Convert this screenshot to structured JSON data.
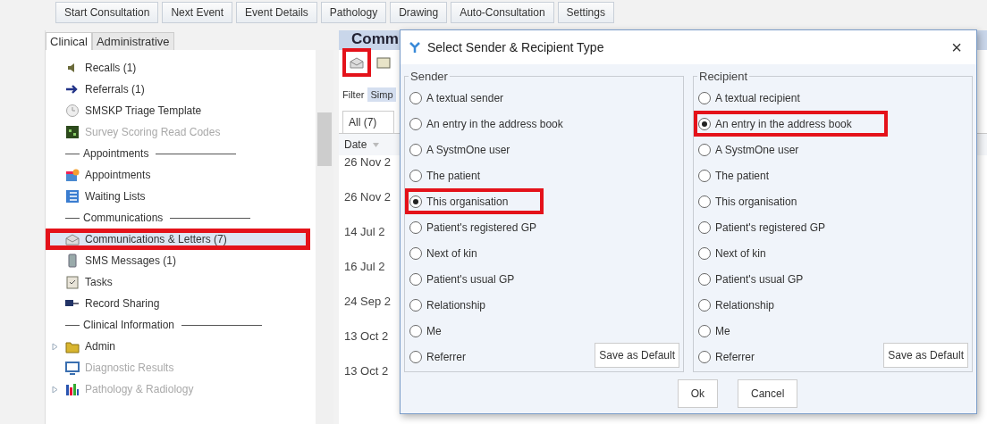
{
  "toolbar": {
    "buttons": [
      "Start Consultation",
      "Next Event",
      "Event Details",
      "Pathology",
      "Drawing",
      "Auto-Consultation",
      "Settings"
    ]
  },
  "sidebar": {
    "tabs": [
      {
        "label": "Clinical",
        "selected": true
      },
      {
        "label": "Administrative",
        "selected": false
      }
    ],
    "items": [
      {
        "kind": "item",
        "label": "Recalls (1)",
        "disabled": false,
        "selected": false,
        "highlighted": false
      },
      {
        "kind": "item",
        "label": "Referrals (1)",
        "disabled": false,
        "selected": false,
        "highlighted": false
      },
      {
        "kind": "item",
        "label": "SMSKP Triage Template",
        "disabled": false,
        "selected": false,
        "highlighted": false
      },
      {
        "kind": "item",
        "label": "Survey Scoring Read Codes",
        "disabled": true,
        "selected": false,
        "highlighted": false
      },
      {
        "kind": "heading",
        "label": "Appointments"
      },
      {
        "kind": "item",
        "label": "Appointments",
        "disabled": false,
        "selected": false,
        "highlighted": false
      },
      {
        "kind": "item",
        "label": "Waiting Lists",
        "disabled": false,
        "selected": false,
        "highlighted": false
      },
      {
        "kind": "heading",
        "label": "Communications"
      },
      {
        "kind": "item",
        "label": "Communications & Letters (7)",
        "disabled": false,
        "selected": true,
        "highlighted": true
      },
      {
        "kind": "item",
        "label": "SMS Messages (1)",
        "disabled": false,
        "selected": false,
        "highlighted": false
      },
      {
        "kind": "item",
        "label": "Tasks",
        "disabled": false,
        "selected": false,
        "highlighted": false
      },
      {
        "kind": "item",
        "label": "Record Sharing",
        "disabled": false,
        "selected": false,
        "highlighted": false
      },
      {
        "kind": "heading",
        "label": "Clinical Information"
      },
      {
        "kind": "group",
        "label": "Admin",
        "disabled": false,
        "selected": false,
        "highlighted": false,
        "expanded": false
      },
      {
        "kind": "item",
        "label": "Diagnostic Results",
        "disabled": true,
        "selected": false,
        "highlighted": false
      },
      {
        "kind": "group",
        "label": "Pathology & Radiology",
        "disabled": true,
        "selected": false,
        "highlighted": false,
        "expanded": false
      }
    ]
  },
  "main": {
    "title": "Comm",
    "toolbar_icons": [
      {
        "highlighted": true
      },
      {
        "highlighted": false
      }
    ],
    "filter_label": "Filter",
    "filter_option": "Simp",
    "tab": "All (7)",
    "column": "Date",
    "rows": [
      "26 Nov 2",
      "26 Nov 2",
      "14 Jul 2",
      "16 Jul 2",
      "24 Sep 2",
      "13 Oct 2",
      "13 Oct 2"
    ]
  },
  "dialog": {
    "title": "Select Sender & Recipient Type",
    "close": "×",
    "groups": [
      {
        "legend": "Sender",
        "save_button": "Save as Default",
        "options": [
          {
            "label": "A textual sender",
            "selected": false,
            "highlighted": false
          },
          {
            "label": "An entry in the address book",
            "selected": false,
            "highlighted": false
          },
          {
            "label": "A SystmOne user",
            "selected": false,
            "highlighted": false
          },
          {
            "label": "The patient",
            "selected": false,
            "highlighted": false
          },
          {
            "label": "This organisation",
            "selected": true,
            "highlighted": true
          },
          {
            "label": "Patient's registered GP",
            "selected": false,
            "highlighted": false
          },
          {
            "label": "Next of kin",
            "selected": false,
            "highlighted": false
          },
          {
            "label": "Patient's usual GP",
            "selected": false,
            "highlighted": false
          },
          {
            "label": "Relationship",
            "selected": false,
            "highlighted": false
          },
          {
            "label": "Me",
            "selected": false,
            "highlighted": false
          },
          {
            "label": "Referrer",
            "selected": false,
            "highlighted": false
          }
        ]
      },
      {
        "legend": "Recipient",
        "save_button": "Save as Default",
        "options": [
          {
            "label": "A textual recipient",
            "selected": false,
            "highlighted": false
          },
          {
            "label": "An entry in the address book",
            "selected": true,
            "highlighted": true
          },
          {
            "label": "A SystmOne user",
            "selected": false,
            "highlighted": false
          },
          {
            "label": "The patient",
            "selected": false,
            "highlighted": false
          },
          {
            "label": "This organisation",
            "selected": false,
            "highlighted": false
          },
          {
            "label": "Patient's registered GP",
            "selected": false,
            "highlighted": false
          },
          {
            "label": "Next of kin",
            "selected": false,
            "highlighted": false
          },
          {
            "label": "Patient's usual GP",
            "selected": false,
            "highlighted": false
          },
          {
            "label": "Relationship",
            "selected": false,
            "highlighted": false
          },
          {
            "label": "Me",
            "selected": false,
            "highlighted": false
          },
          {
            "label": "Referrer",
            "selected": false,
            "highlighted": false
          }
        ]
      }
    ],
    "buttons": [
      "Ok",
      "Cancel"
    ]
  }
}
